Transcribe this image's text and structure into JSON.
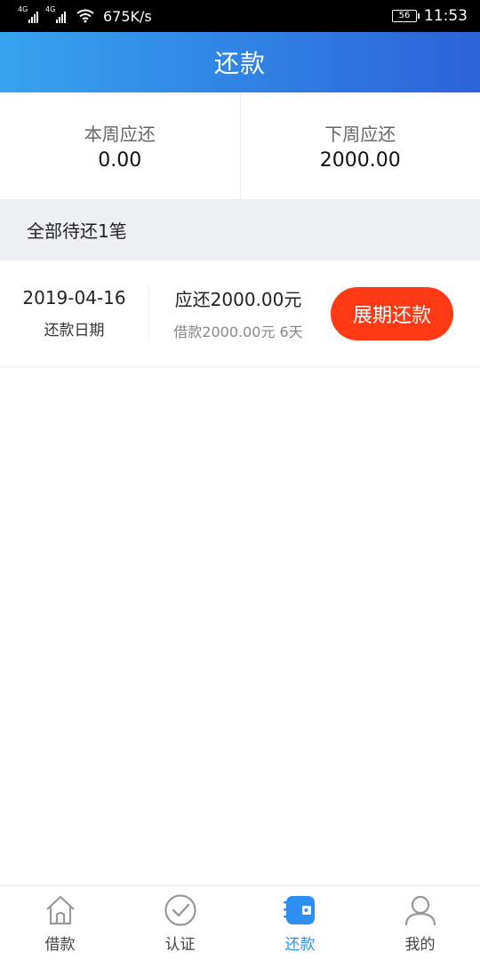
{
  "status_bar": {
    "signal1_label": "4G",
    "signal2_label": "4G",
    "speed": "675K/s",
    "battery": "56",
    "time": "11:53"
  },
  "header": {
    "title": "还款"
  },
  "summary": {
    "this_week_label": "本周应还",
    "this_week_value": "0.00",
    "next_week_label": "下周应还",
    "next_week_value": "2000.00"
  },
  "section": {
    "title": "全部待还1笔"
  },
  "loan": {
    "date": "2019-04-16",
    "date_label": "还款日期",
    "due": "应还2000.00元",
    "detail": "借款2000.00元 6天",
    "button": "展期还款"
  },
  "nav": {
    "items": [
      {
        "label": "借款",
        "icon": "home-icon"
      },
      {
        "label": "认证",
        "icon": "check-circle-icon"
      },
      {
        "label": "还款",
        "icon": "wallet-icon"
      },
      {
        "label": "我的",
        "icon": "user-icon"
      }
    ],
    "active_color": "#2f8ff0"
  },
  "colors": {
    "header_gradient_start": "#36a3f0",
    "header_gradient_end": "#2b63d8",
    "button": "#ff3a14",
    "section_bg": "#eff0f4"
  }
}
